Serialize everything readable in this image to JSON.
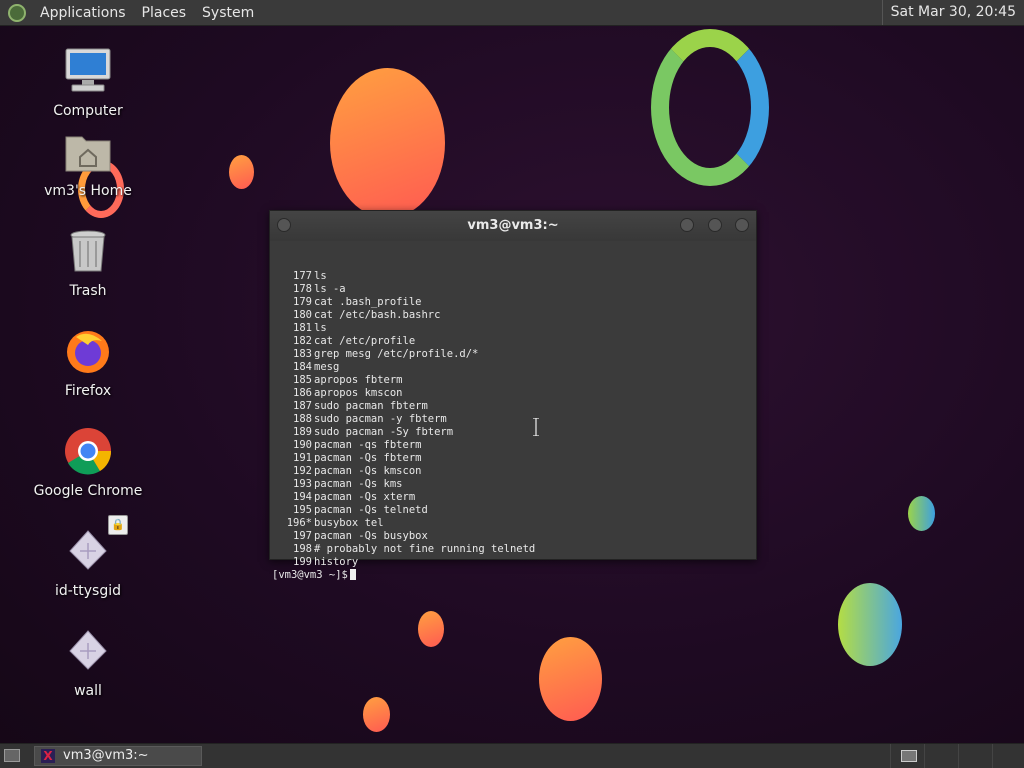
{
  "top_panel": {
    "menus": [
      "Applications",
      "Places",
      "System"
    ],
    "clock": "Sat Mar 30, 20:45"
  },
  "desktop": {
    "icons": [
      {
        "label": "Computer",
        "icon": "computer-icon"
      },
      {
        "label": "vm3's Home",
        "icon": "home-folder-icon"
      },
      {
        "label": "Trash",
        "icon": "trash-icon"
      },
      {
        "label": "Firefox",
        "icon": "firefox-icon"
      },
      {
        "label": "Google Chrome",
        "icon": "chrome-icon"
      },
      {
        "label": "id-ttysgid",
        "icon": "script-file-icon"
      },
      {
        "label": "wall",
        "icon": "script-file-icon"
      }
    ]
  },
  "terminal": {
    "title": "vm3@vm3:~",
    "history": [
      {
        "n": "177",
        "cmd": "ls"
      },
      {
        "n": "178",
        "cmd": "ls -a"
      },
      {
        "n": "179",
        "cmd": "cat .bash_profile"
      },
      {
        "n": "180",
        "cmd": "cat /etc/bash.bashrc"
      },
      {
        "n": "181",
        "cmd": "ls"
      },
      {
        "n": "182",
        "cmd": "cat /etc/profile"
      },
      {
        "n": "183",
        "cmd": "grep mesg /etc/profile.d/*"
      },
      {
        "n": "184",
        "cmd": "mesg"
      },
      {
        "n": "185",
        "cmd": "apropos fbterm"
      },
      {
        "n": "186",
        "cmd": "apropos kmscon"
      },
      {
        "n": "187",
        "cmd": "sudo pacman fbterm"
      },
      {
        "n": "188",
        "cmd": "sudo pacman -y fbterm"
      },
      {
        "n": "189",
        "cmd": "sudo pacman -Sy fbterm"
      },
      {
        "n": "190",
        "cmd": "pacman -qs fbterm"
      },
      {
        "n": "191",
        "cmd": "pacman -Qs fbterm"
      },
      {
        "n": "192",
        "cmd": "pacman -Qs kmscon"
      },
      {
        "n": "193",
        "cmd": "pacman -Qs kms"
      },
      {
        "n": "194",
        "cmd": "pacman -Qs xterm"
      },
      {
        "n": "195",
        "cmd": "pacman -Qs telnetd"
      },
      {
        "n": "196*",
        "cmd": "busybox tel"
      },
      {
        "n": "197",
        "cmd": "pacman -Qs busybox"
      },
      {
        "n": "198",
        "cmd": "# probably not fine running telnetd"
      },
      {
        "n": "199",
        "cmd": "history"
      }
    ],
    "prompt": "[vm3@vm3 ~]$"
  },
  "taskbar": {
    "window_label": "vm3@vm3:~"
  },
  "colors": {
    "panel": "#3a3a3a",
    "terminal_bg": "#3b3b3b",
    "desktop_bg": "#1e0a22"
  }
}
